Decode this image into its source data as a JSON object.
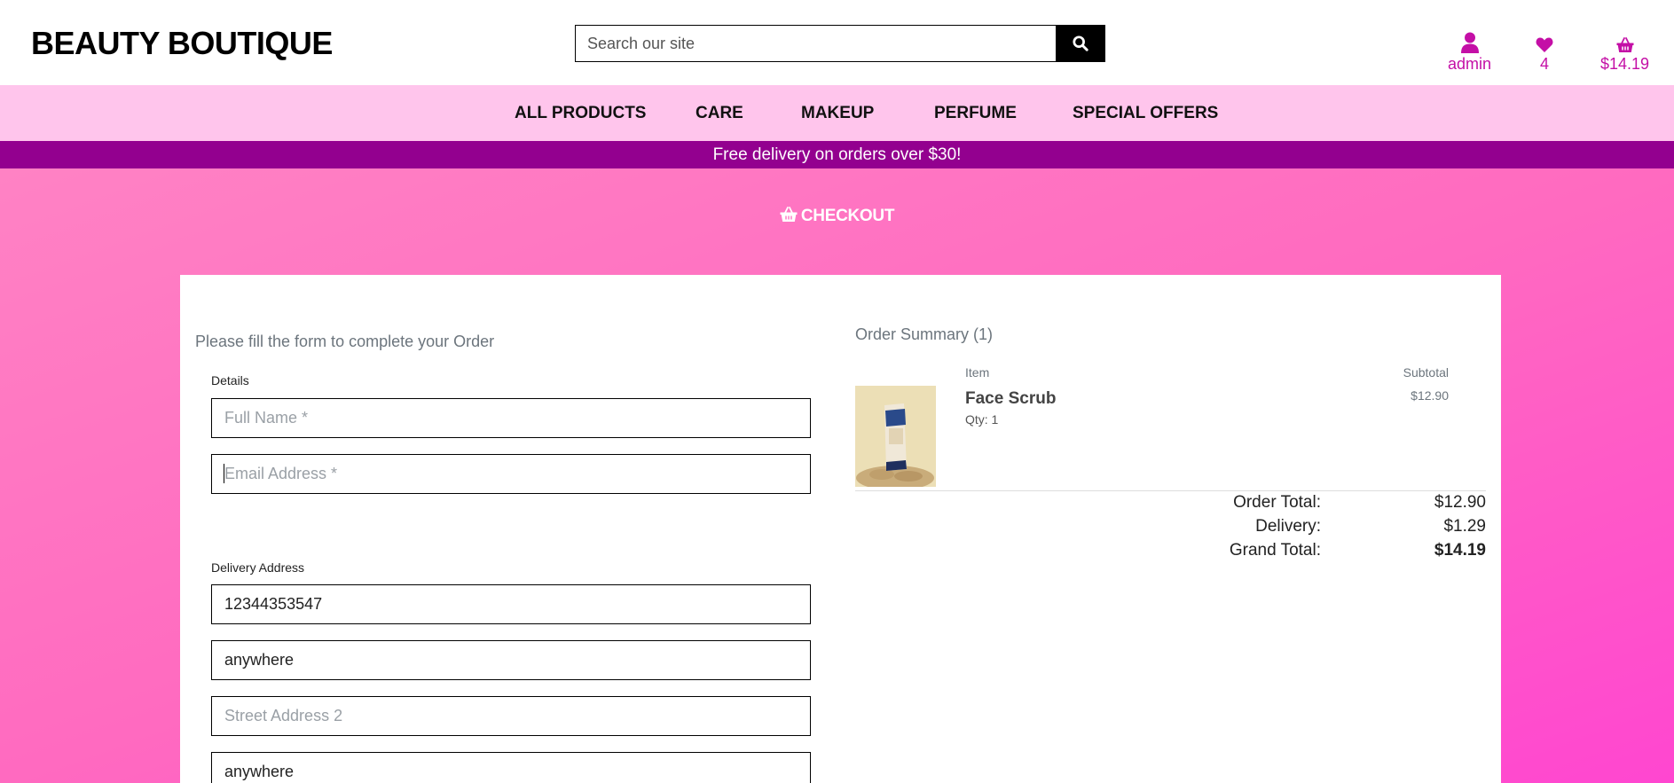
{
  "header": {
    "logo": "BEAUTY BOUTIQUE",
    "search_placeholder": "Search our site",
    "account_label": "admin",
    "wishlist_count": "4",
    "cart_total": "$14.19"
  },
  "nav": {
    "items": [
      "ALL PRODUCTS",
      "CARE",
      "MAKEUP",
      "PERFUME",
      "SPECIAL OFFERS"
    ]
  },
  "banner": "Free delivery on orders over $30!",
  "checkout": {
    "title": "CHECKOUT"
  },
  "form": {
    "intro": "Please fill the form to complete your Order",
    "details_legend": "Details",
    "full_name_placeholder": "Full Name *",
    "email_placeholder": "Email Address *",
    "delivery_legend": "Delivery Address",
    "phone_value": "12344353547",
    "street1_value": "anywhere",
    "street2_placeholder": "Street Address 2",
    "town_value": "anywhere"
  },
  "summary": {
    "title": "Order Summary (1)",
    "item_header": "Item",
    "subtotal_header": "Subtotal",
    "item": {
      "name": "Face Scrub",
      "qty": "Qty: 1",
      "subtotal": "$12.90"
    },
    "order_total_label": "Order Total:",
    "order_total": "$12.90",
    "delivery_label": "Delivery:",
    "delivery": "$1.29",
    "grand_total_label": "Grand Total:",
    "grand_total": "$14.19"
  },
  "colors": {
    "accent": "#c40fa6",
    "nav_bg": "#ffc5ec",
    "banner_bg": "#93008f",
    "main_gradient_start": "#ff82c4",
    "main_gradient_end": "#ff46d0"
  }
}
